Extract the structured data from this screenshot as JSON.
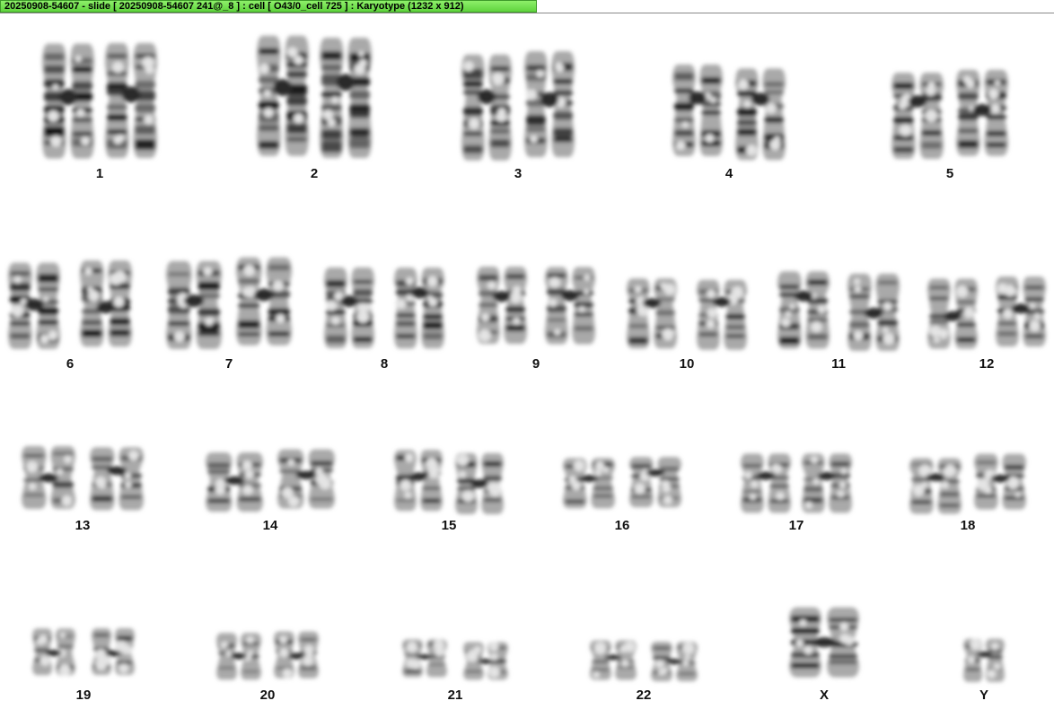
{
  "window_title": "20250908-54607 - slide [ 20250908-54607 241@_8 ] : cell [ O43/0_cell 725 ] : Karyotype  (1232 x 912)",
  "karyotype": {
    "rows": [
      {
        "chromosomes": [
          "1",
          "2",
          "3",
          "4",
          "5"
        ]
      },
      {
        "chromosomes": [
          "6",
          "7",
          "8",
          "9",
          "10",
          "11",
          "12"
        ]
      },
      {
        "chromosomes": [
          "13",
          "14",
          "15",
          "16",
          "17",
          "18"
        ]
      },
      {
        "chromosomes": [
          "19",
          "20",
          "21",
          "22",
          "X",
          "Y"
        ]
      }
    ],
    "sex_chromosomes": {
      "x_count": 1,
      "y_count": 1
    }
  }
}
